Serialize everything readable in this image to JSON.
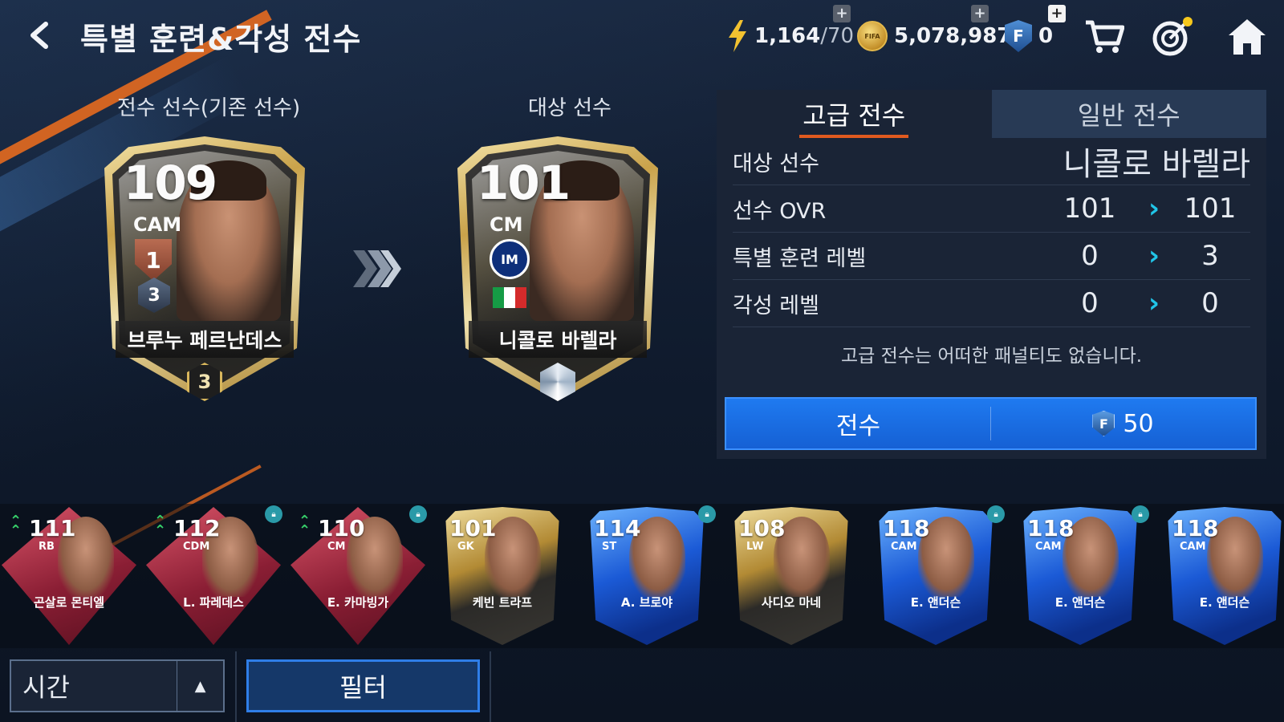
{
  "header": {
    "title": "특별 훈련&각성 전수",
    "stamina": "1,164",
    "stamina_max": "/70",
    "coins": "5,078,987",
    "fc_points": "0",
    "coin_label": "FIFA"
  },
  "labels": {
    "source_player": "전수 선수(기존 선수)",
    "target_player": "대상 선수"
  },
  "source_card": {
    "ovr": "109",
    "position": "CAM",
    "grade": "1",
    "level": "3",
    "name": "브루누 페르난데스",
    "enhance": "3"
  },
  "target_card": {
    "ovr": "101",
    "position": "CM",
    "club": "IM",
    "name": "니콜로 바렐라"
  },
  "panel": {
    "tabs": [
      {
        "label": "고급 전수",
        "active": true
      },
      {
        "label": "일반 전수",
        "active": false
      }
    ],
    "target_label": "대상 선수",
    "target_name": "니콜로 바렐라",
    "rows": [
      {
        "label": "선수 OVR",
        "from": "101",
        "to": "101"
      },
      {
        "label": "특별 훈련 레벨",
        "from": "0",
        "to": "3"
      },
      {
        "label": "각성 레벨",
        "from": "0",
        "to": "0"
      }
    ],
    "note": "고급 전수는 어떠한 패널티도 없습니다.",
    "action_label": "전수",
    "cost": "50",
    "cost_icon": "F"
  },
  "players": [
    {
      "ovr": "111",
      "pos": "RB",
      "name": "곤살로 몬티엘",
      "style": "red",
      "upgrade": true,
      "locked": false
    },
    {
      "ovr": "112",
      "pos": "CDM",
      "name": "L. 파레데스",
      "style": "red",
      "upgrade": true,
      "locked": true
    },
    {
      "ovr": "110",
      "pos": "CM",
      "name": "E. 카마빙가",
      "style": "red",
      "upgrade": true,
      "locked": true
    },
    {
      "ovr": "101",
      "pos": "GK",
      "name": "케빈 트라프",
      "style": "gold",
      "upgrade": false,
      "locked": false
    },
    {
      "ovr": "114",
      "pos": "ST",
      "name": "A. 브로야",
      "style": "blue",
      "upgrade": false,
      "locked": true
    },
    {
      "ovr": "108",
      "pos": "LW",
      "name": "사디오 마네",
      "style": "gold",
      "upgrade": false,
      "locked": false
    },
    {
      "ovr": "118",
      "pos": "CAM",
      "name": "E. 앤더슨",
      "style": "blue",
      "upgrade": false,
      "locked": true
    },
    {
      "ovr": "118",
      "pos": "CAM",
      "name": "E. 앤더슨",
      "style": "blue",
      "upgrade": false,
      "locked": true
    },
    {
      "ovr": "118",
      "pos": "CAM",
      "name": "E. 앤더슨",
      "style": "blue",
      "upgrade": false,
      "locked": false
    }
  ],
  "controls": {
    "sort_label": "시간",
    "filter_label": "필터"
  },
  "colors": {
    "accent_orange": "#e05a1f",
    "button_blue": "#1f7af0",
    "chevron_cyan": "#21c5e8"
  }
}
